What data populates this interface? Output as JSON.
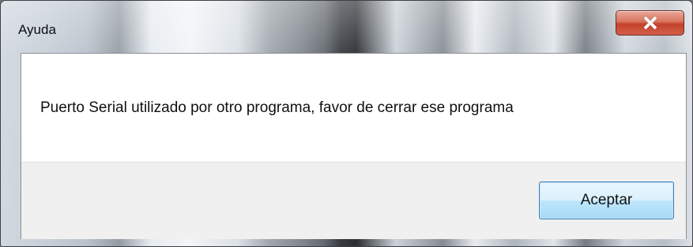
{
  "window": {
    "title": "Ayuda",
    "close_icon": "close-icon",
    "close_color": "#c4412a"
  },
  "dialog": {
    "message": "Puerto Serial utilizado por otro programa, favor de cerrar ese programa",
    "ok_label": "Aceptar",
    "ok_color": "#a7d9f5"
  }
}
